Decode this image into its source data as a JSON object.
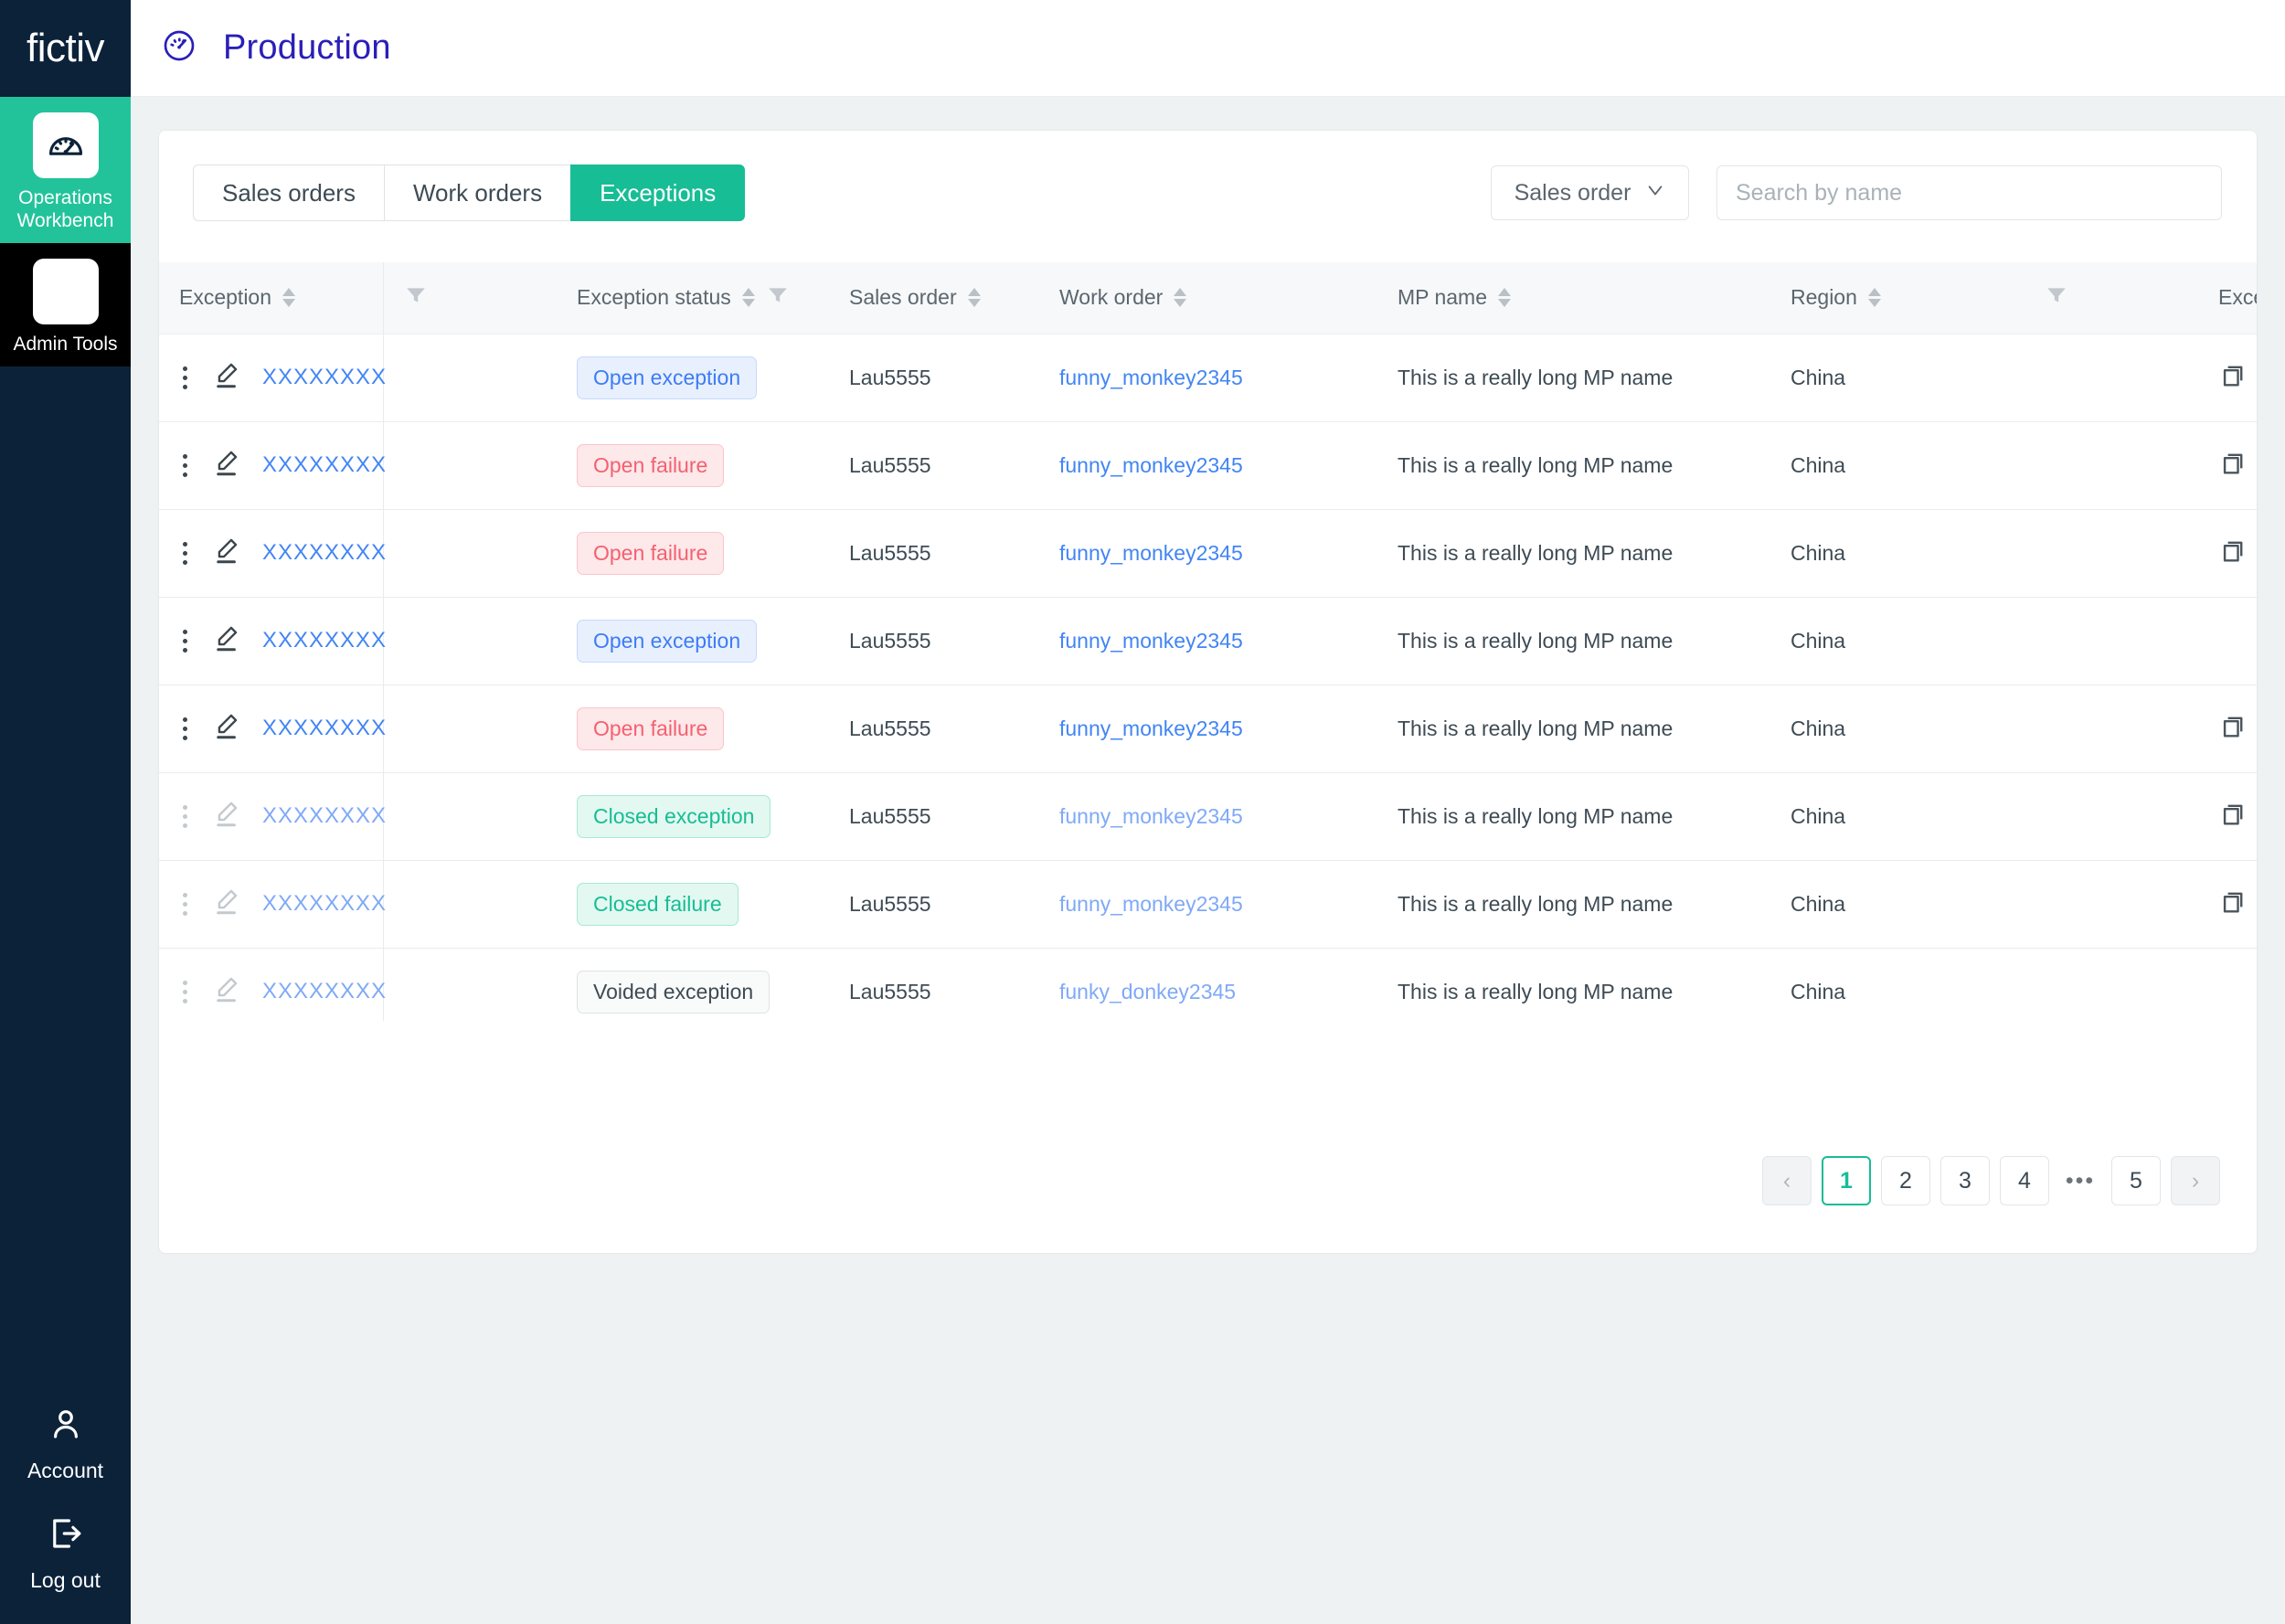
{
  "brand": {
    "name": "fictiv"
  },
  "sidebar": {
    "items": [
      {
        "label": "Operations Workbench",
        "icon": "speedometer-icon",
        "active": true
      },
      {
        "label": "Admin Tools",
        "icon": "blank-tile-icon",
        "active": false
      }
    ],
    "bottom": [
      {
        "label": "Account",
        "icon": "user-icon"
      },
      {
        "label": "Log out",
        "icon": "logout-icon"
      }
    ]
  },
  "header": {
    "title": "Production",
    "icon": "speedometer-icon"
  },
  "tabs": [
    {
      "label": "Sales orders",
      "active": false
    },
    {
      "label": "Work orders",
      "active": false
    },
    {
      "label": "Exceptions",
      "active": true
    }
  ],
  "filter_select": {
    "label": "Sales order",
    "icon": "chevron-down-icon"
  },
  "search": {
    "placeholder": "Search by name",
    "value": ""
  },
  "table": {
    "columns": [
      {
        "key": "exception",
        "label": "Exception",
        "sortable": true,
        "filterable": true
      },
      {
        "key": "exception_status",
        "label": "Exception status",
        "sortable": true,
        "filterable": true
      },
      {
        "key": "sales_order",
        "label": "Sales order",
        "sortable": true,
        "filterable": false
      },
      {
        "key": "work_order",
        "label": "Work order",
        "sortable": true,
        "filterable": false
      },
      {
        "key": "mp_name",
        "label": "MP name",
        "sortable": true,
        "filterable": false
      },
      {
        "key": "region",
        "label": "Region",
        "sortable": true,
        "filterable": true
      },
      {
        "key": "exception_type",
        "label": "Exception ty",
        "sortable": false,
        "filterable": false
      }
    ],
    "rows": [
      {
        "exception": "XXXXXXXX",
        "status": "Open exception",
        "status_kind": "open-exception",
        "sales_order": "Lau5555",
        "work_order": "funny_monkey2345",
        "mp_name": "This is a really long MP name",
        "region": "China",
        "has_copy": true,
        "dim": false
      },
      {
        "exception": "XXXXXXXX",
        "status": "Open failure",
        "status_kind": "open-failure",
        "sales_order": "Lau5555",
        "work_order": "funny_monkey2345",
        "mp_name": "This is a really long MP name",
        "region": "China",
        "has_copy": true,
        "dim": false
      },
      {
        "exception": "XXXXXXXX",
        "status": "Open failure",
        "status_kind": "open-failure",
        "sales_order": "Lau5555",
        "work_order": "funny_monkey2345",
        "mp_name": "This is a really long MP name",
        "region": "China",
        "has_copy": true,
        "dim": false
      },
      {
        "exception": "XXXXXXXX",
        "status": "Open exception",
        "status_kind": "open-exception",
        "sales_order": "Lau5555",
        "work_order": "funny_monkey2345",
        "mp_name": "This is a really long MP name",
        "region": "China",
        "has_copy": false,
        "dim": false
      },
      {
        "exception": "XXXXXXXX",
        "status": "Open failure",
        "status_kind": "open-failure",
        "sales_order": "Lau5555",
        "work_order": "funny_monkey2345",
        "mp_name": "This is a really long MP name",
        "region": "China",
        "has_copy": true,
        "dim": false
      },
      {
        "exception": "XXXXXXXX",
        "status": "Closed exception",
        "status_kind": "closed",
        "sales_order": "Lau5555",
        "work_order": "funny_monkey2345",
        "mp_name": "This is a really long MP name",
        "region": "China",
        "has_copy": true,
        "dim": true
      },
      {
        "exception": "XXXXXXXX",
        "status": "Closed failure",
        "status_kind": "closed",
        "sales_order": "Lau5555",
        "work_order": "funny_monkey2345",
        "mp_name": "This is a really long MP name",
        "region": "China",
        "has_copy": true,
        "dim": true
      },
      {
        "exception": "XXXXXXXX",
        "status": "Voided exception",
        "status_kind": "voided",
        "sales_order": "Lau5555",
        "work_order": "funky_donkey2345",
        "mp_name": "This is a really long MP name",
        "region": "China",
        "has_copy": false,
        "dim": true
      }
    ]
  },
  "pagination": {
    "prev": "‹",
    "next": "›",
    "ellipsis": "•••",
    "pages": [
      "1",
      "2",
      "3",
      "4"
    ],
    "last": "5",
    "current": "1"
  },
  "colors": {
    "accent_green": "#17bd95",
    "sidebar_navy": "#0b2239",
    "title_indigo": "#2a1fb8",
    "link_blue": "#4285f4",
    "danger_red": "#f4616f"
  }
}
